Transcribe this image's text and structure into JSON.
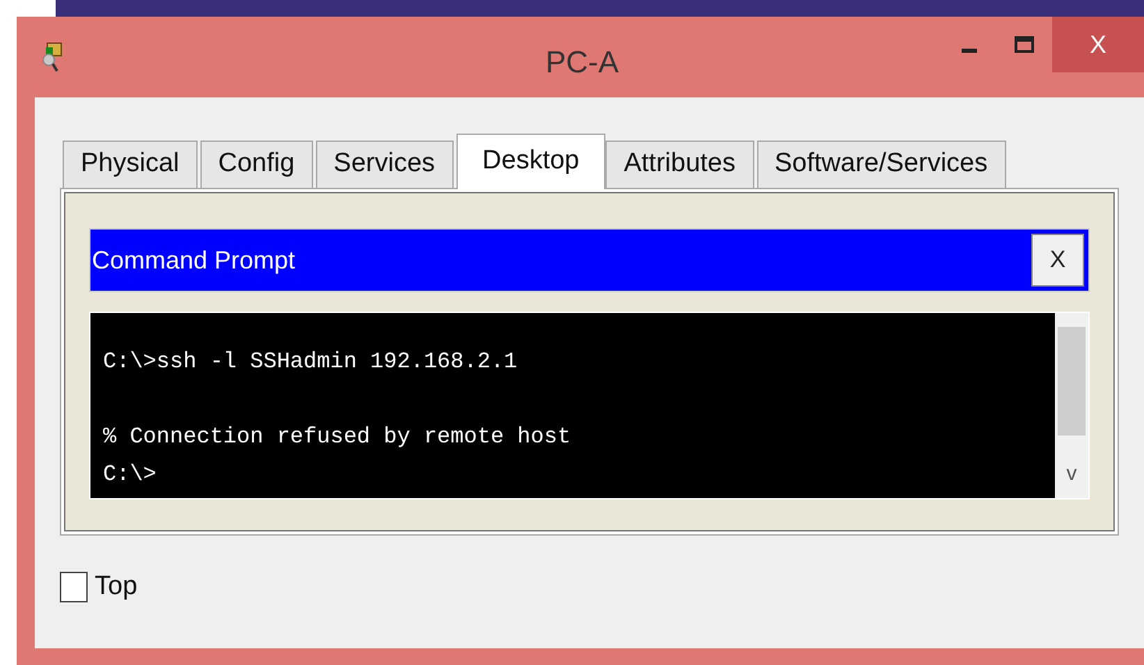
{
  "window": {
    "title": "PC-A",
    "close": "X"
  },
  "tabs": [
    {
      "label": "Physical",
      "selected": false
    },
    {
      "label": "Config",
      "selected": false
    },
    {
      "label": "Services",
      "selected": false
    },
    {
      "label": "Desktop",
      "selected": true
    },
    {
      "label": "Attributes",
      "selected": false
    },
    {
      "label": "Software/Services",
      "selected": false
    }
  ],
  "command_prompt": {
    "title": "Command Prompt",
    "close": "X",
    "output": "C:\\>ssh -l SSHadmin 192.168.2.1\n\n% Connection refused by remote host\nC:\\>",
    "scroll_down": "v"
  },
  "top_checkbox": {
    "label": "Top",
    "checked": false
  }
}
